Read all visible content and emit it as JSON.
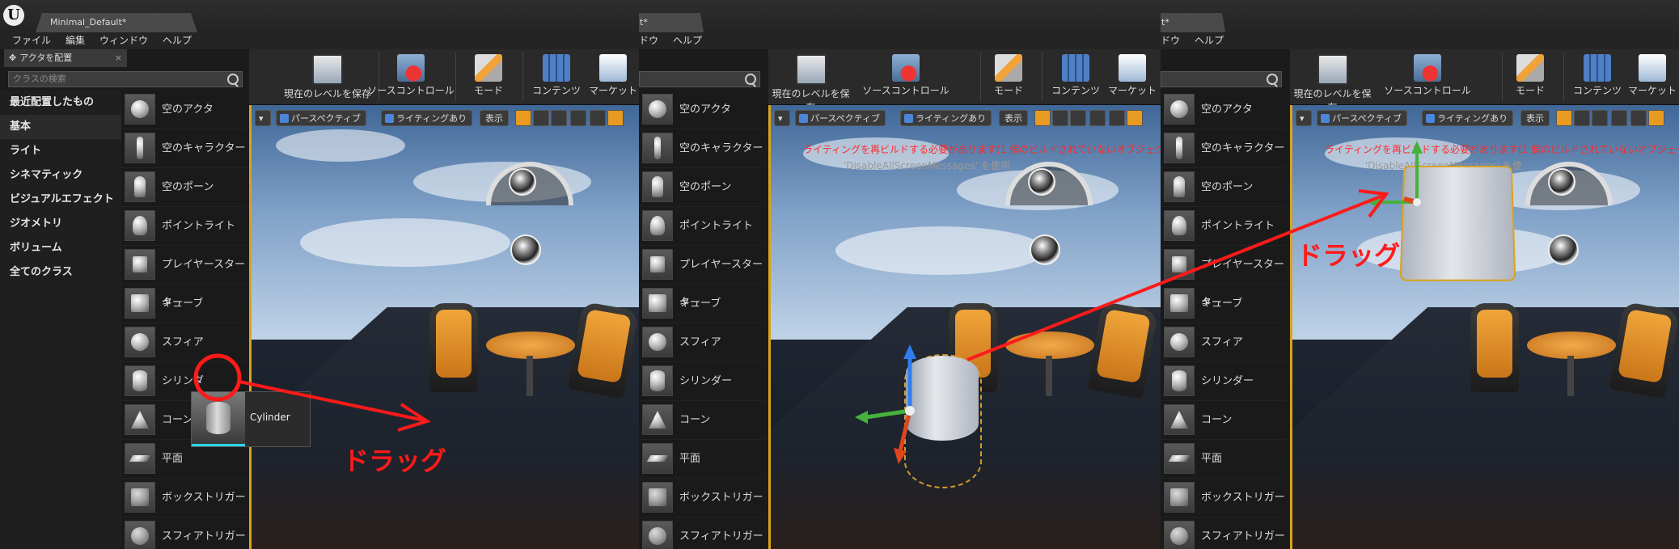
{
  "app": {
    "doc_tab": "Minimal_Default*",
    "doc_tab_partial": "lt*",
    "place_actors_tab": "アクタを配置",
    "search_placeholder": "クラスの検索"
  },
  "menu": {
    "items": [
      "ファイル",
      "編集",
      "ウィンドウ",
      "ヘルプ"
    ],
    "partial_items": [
      "ドウ",
      "ヘルプ"
    ]
  },
  "categories": [
    "最近配置したもの",
    "基本",
    "ライト",
    "シネマティック",
    "ビジュアルエフェクト",
    "ジオメトリ",
    "ボリューム",
    "全てのクラス"
  ],
  "selected_category": "基本",
  "actor_items": [
    {
      "label": "空のアクタ",
      "icon": "sphere-icon"
    },
    {
      "label": "空のキャラクター",
      "icon": "character-icon"
    },
    {
      "label": "空のポーン",
      "icon": "pawn-icon"
    },
    {
      "label": "ポイントライト",
      "icon": "light-bulb-icon"
    },
    {
      "label": "プレイヤースターター",
      "icon": "player-start-icon"
    },
    {
      "label": "キューブ",
      "icon": "cube-icon"
    },
    {
      "label": "スフィア",
      "icon": "sphere-icon"
    },
    {
      "label": "シリンダー",
      "icon": "cylinder-icon"
    },
    {
      "label": "コーン",
      "icon": "cone-icon"
    },
    {
      "label": "平面",
      "icon": "plane-icon"
    },
    {
      "label": "ボックストリガー",
      "icon": "box-trigger-icon"
    },
    {
      "label": "スフィアトリガー",
      "icon": "sphere-trigger-icon"
    }
  ],
  "panel1_partial_labels": {
    "cylinder": "シリンダ",
    "cone": "コーン"
  },
  "toolbar": {
    "save": "現在のレベルを保存",
    "source_control": "ソースコントロール",
    "modes": "モード",
    "content": "コンテンツ",
    "marketplace": "マーケット"
  },
  "viewport": {
    "perspective": "パースペクティブ",
    "lit": "ライティングあり",
    "show": "表示",
    "rebuild_message": "ライティングを再ビルドする必要があります(1 個のビルドされていないオブジェク",
    "disable_message": "'DisableAllScreenMessages' を使用",
    "disable_message_2": "'DisableAllScreenMessages' を使"
  },
  "tooltip": {
    "label": "Cylinder"
  },
  "annotations": {
    "drag_label": "ドラッグ",
    "color": "#ff1a1a"
  },
  "colors": {
    "accent": "#d9a31b",
    "selection": "#2dd6e6"
  }
}
